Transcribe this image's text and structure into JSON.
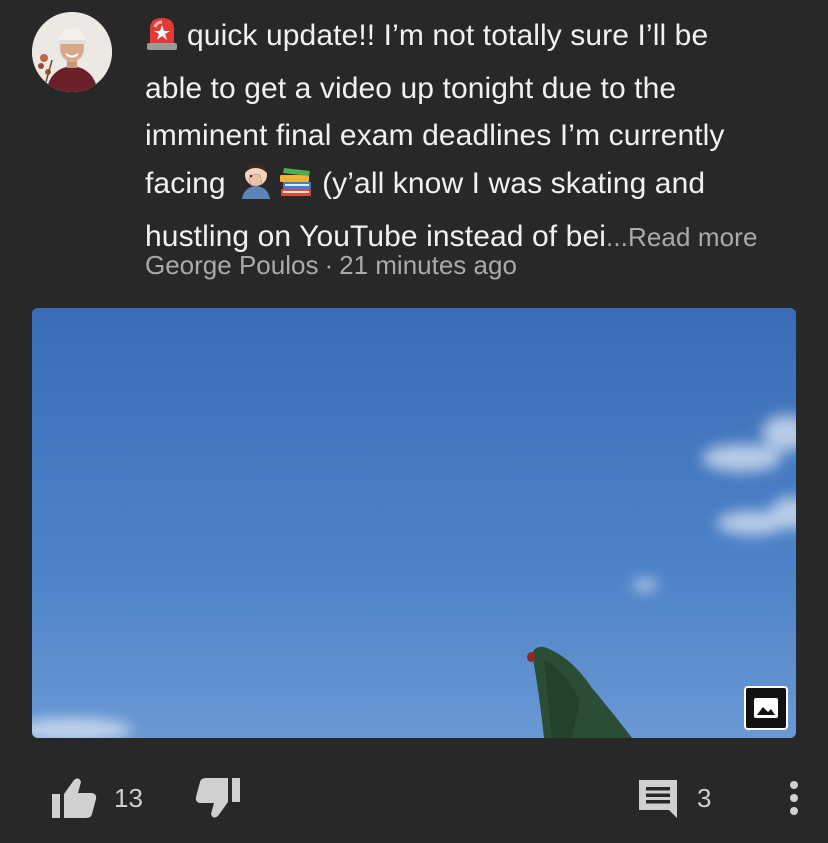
{
  "post": {
    "text_lines": [
      "quick update!! I’m not totally sure I’ll be",
      "able to get a video up tonight due to the",
      "imminent final exam deadlines I’m currently",
      "facing",
      "(y’all know I was skating and",
      "hustling on YouTube instead of bei"
    ],
    "ellipsis": "...",
    "read_more": "Read more",
    "author": "George Poulos",
    "separator": "·",
    "time": "21 minutes ago",
    "emojis": [
      "police-light-emoji",
      "facepalm-emoji",
      "books-emoji"
    ]
  },
  "actions": {
    "like_count": "13",
    "comment_count": "3"
  },
  "icons": {
    "like": "thumbs-up-icon",
    "dislike": "thumbs-down-icon",
    "comments": "comment-icon",
    "more": "more-vert-icon",
    "image": "image-icon"
  },
  "colors": {
    "background": "#282828",
    "text": "#f1f1f1",
    "secondary_text": "#aaaaaa",
    "sky": "#4b7cc2"
  }
}
